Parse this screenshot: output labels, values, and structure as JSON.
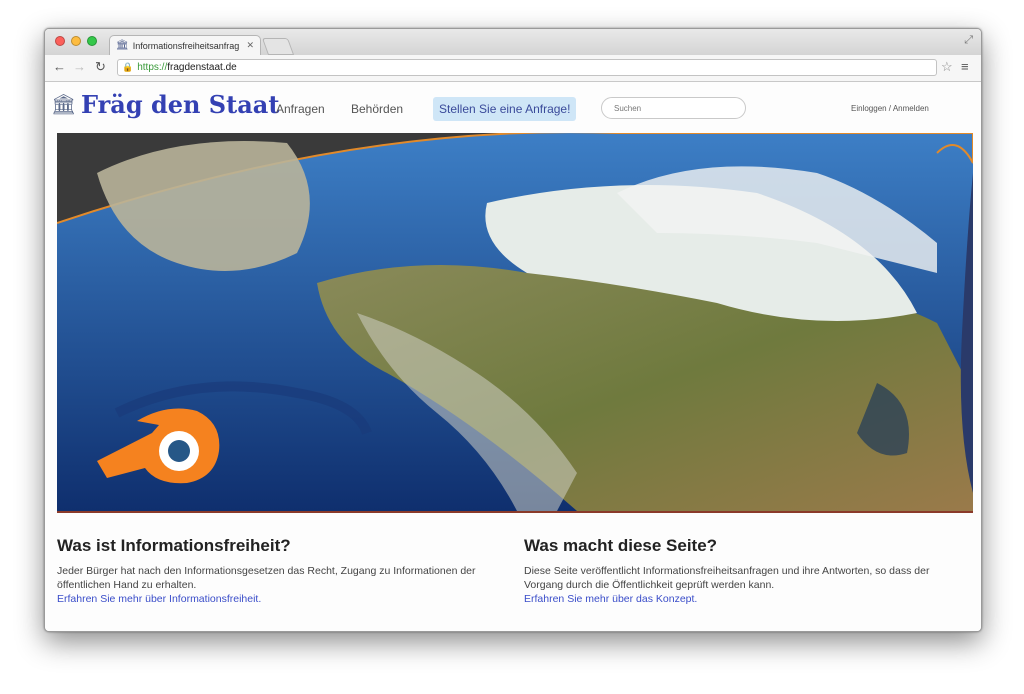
{
  "browser": {
    "tab_title": "Informationsfreiheitsanfrag",
    "url_scheme": "https://",
    "url_host": "fragdenstaat.de"
  },
  "site": {
    "logo_text": "Fräg den Staat",
    "nav": {
      "anfragen": "Anfragen",
      "behoerden": "Behörden",
      "cta": "Stellen Sie eine Anfrage!"
    },
    "search_placeholder": "Suchen",
    "login": "Einloggen / Anmelden"
  },
  "colors": {
    "logo": "#3441b3",
    "cta_bg": "#cfe6f7",
    "link": "#3a4dc9",
    "blender_orange": "#f5821f",
    "blender_blue": "#265787"
  },
  "info": {
    "left": {
      "heading": "Was ist Informationsfreiheit?",
      "text": "Jeder Bürger hat nach den Informationsgesetzen das Recht, Zugang zu Informationen der öffentlichen Hand zu erhalten.",
      "link": "Erfahren Sie mehr über Informationsfreiheit."
    },
    "right": {
      "heading": "Was macht diese Seite?",
      "text": "Diese Seite veröffentlicht Informationsfreiheitsanfragen und ihre Antworten, so dass der Vorgang durch die Öffentlichkeit geprüft werden kann.",
      "link": "Erfahren Sie mehr über das Konzept."
    }
  }
}
